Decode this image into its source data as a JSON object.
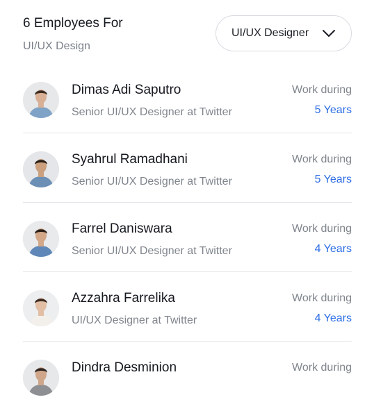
{
  "header": {
    "title": "6 Employees For",
    "subtitle": "UI/UX Design",
    "role_filter": {
      "selected": "UI/UX Designer",
      "icon": "chevron-down-icon"
    }
  },
  "employees": [
    {
      "name": "Dimas Adi Saputro",
      "role": "Senior UI/UX Designer at Twitter",
      "work_label": "Work during",
      "years": "5 Years",
      "avatar_colors": {
        "shirt": "#7fa3c6",
        "hair": "#3a2a20",
        "skin": "#d8b096",
        "bg": "#e6e8ea"
      }
    },
    {
      "name": "Syahrul Ramadhani",
      "role": "Senior UI/UX Designer at Twitter",
      "work_label": "Work during",
      "years": "5 Years",
      "avatar_colors": {
        "shirt": "#6b8fb5",
        "hair": "#2b2018",
        "skin": "#caa07e",
        "bg": "#e4e6e9"
      }
    },
    {
      "name": "Farrel Daniswara",
      "role": "Senior UI/UX Designer at Twitter",
      "work_label": "Work during",
      "years": "4 Years",
      "avatar_colors": {
        "shirt": "#5f87b8",
        "hair": "#2a1f18",
        "skin": "#d2a888",
        "bg": "#e8eaec"
      }
    },
    {
      "name": "Azzahra Farrelika",
      "role": "UI/UX Designer at Twitter",
      "work_label": "Work during",
      "years": "4 Years",
      "avatar_colors": {
        "shirt": "#f3f0ec",
        "hair": "#3b2a22",
        "skin": "#e2bea4",
        "bg": "#eceeef"
      }
    },
    {
      "name": "Dindra Desminion",
      "role": "",
      "work_label": "Work during",
      "years": "",
      "avatar_colors": {
        "shirt": "#8d8f93",
        "hair": "#2d2520",
        "skin": "#cfa68a",
        "bg": "#e6e8ea"
      }
    }
  ],
  "colors": {
    "accent": "#2f6fe4",
    "muted_text": "#80858d",
    "divider": "#e3e5e8"
  }
}
